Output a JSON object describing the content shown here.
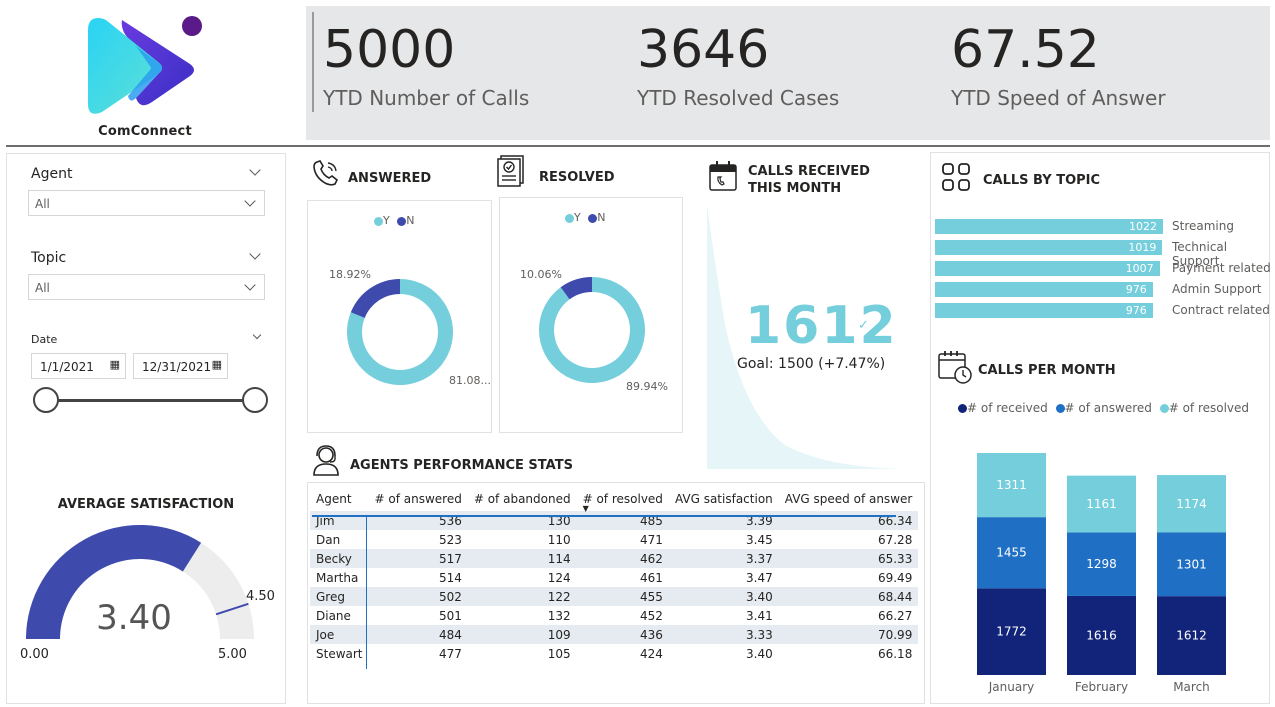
{
  "brand": {
    "name": "ComConnect"
  },
  "kpis": [
    {
      "value": "5000",
      "label": "YTD Number of Calls"
    },
    {
      "value": "3646",
      "label": "YTD Resolved Cases"
    },
    {
      "value": "67.52",
      "label": "YTD Speed of Answer"
    }
  ],
  "filters": {
    "agent": {
      "label": "Agent",
      "value": "All"
    },
    "topic": {
      "label": "Topic",
      "value": "All"
    },
    "date": {
      "label": "Date",
      "start": "1/1/2021",
      "end": "12/31/2021"
    }
  },
  "gauge": {
    "title": "AVERAGE  SATISFACTION",
    "value": 3.4,
    "value_label": "3.40",
    "min": 0,
    "min_label": "0.00",
    "max": 5,
    "max_label": "5.00",
    "target": 4.5,
    "target_label": "4.50",
    "fill_color": "#3e4bad",
    "track_color": "#ededed"
  },
  "answered": {
    "title": "ANSWERED",
    "legend": [
      "Y",
      "N"
    ],
    "y_label": "81.08...",
    "n_label": "18.92%",
    "y_pct": 81.08,
    "n_pct": 18.92
  },
  "resolved": {
    "title": "RESOLVED",
    "legend": [
      "Y",
      "N"
    ],
    "y_label": "89.94%",
    "n_label": "10.06%",
    "y_pct": 89.94,
    "n_pct": 10.06
  },
  "calls_month": {
    "title": "CALLS RECEIVED THIS MONTH",
    "value": "1612",
    "goal_text": "Goal: 1500 (+7.47%)"
  },
  "topics": {
    "title": "CALLS BY TOPIC",
    "items": [
      {
        "label": "Streaming",
        "value": 1022
      },
      {
        "label": "Technical Support",
        "value": 1019
      },
      {
        "label": "Payment related",
        "value": 1007
      },
      {
        "label": "Admin Support",
        "value": 976
      },
      {
        "label": "Contract related",
        "value": 976
      }
    ]
  },
  "per_month": {
    "title": "CALLS PER MONTH",
    "legend": [
      "# of received",
      "# of answered",
      "# of resolved"
    ]
  },
  "chart_data": {
    "type": "bar",
    "categories": [
      "January",
      "February",
      "March"
    ],
    "series": [
      {
        "name": "# of received",
        "values": [
          1772,
          1616,
          1612
        ],
        "color": "#12237a"
      },
      {
        "name": "# of answered",
        "values": [
          1455,
          1298,
          1301
        ],
        "color": "#1f6fc4"
      },
      {
        "name": "# of resolved",
        "values": [
          1311,
          1161,
          1174
        ],
        "color": "#74cedc"
      }
    ],
    "stacked": true,
    "legend_position": "top"
  },
  "agents": {
    "title": "AGENTS PERFORMANCE STATS",
    "columns": [
      "Agent",
      "# of answered",
      "# of abandoned",
      "# of resolved",
      "AVG satisfaction",
      "AVG speed of answer"
    ],
    "rows": [
      [
        "Jim",
        "536",
        "130",
        "485",
        "3.39",
        "66.34"
      ],
      [
        "Dan",
        "523",
        "110",
        "471",
        "3.45",
        "67.28"
      ],
      [
        "Becky",
        "517",
        "114",
        "462",
        "3.37",
        "65.33"
      ],
      [
        "Martha",
        "514",
        "124",
        "461",
        "3.47",
        "69.49"
      ],
      [
        "Greg",
        "502",
        "122",
        "455",
        "3.40",
        "68.44"
      ],
      [
        "Diane",
        "501",
        "132",
        "452",
        "3.41",
        "66.27"
      ],
      [
        "Joe",
        "484",
        "109",
        "436",
        "3.33",
        "70.99"
      ],
      [
        "Stewart",
        "477",
        "105",
        "424",
        "3.40",
        "66.18"
      ]
    ]
  },
  "colors": {
    "teal": "#74cedc",
    "navy": "#3e4bad",
    "kpi_band": "#e6e7e8"
  }
}
